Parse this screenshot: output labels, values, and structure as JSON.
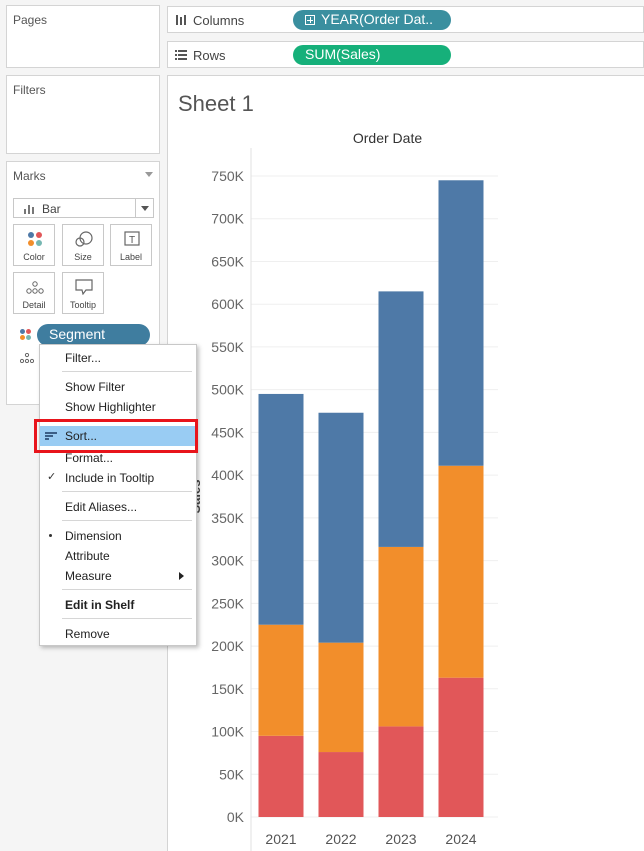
{
  "sidebar": {
    "pages_title": "Pages",
    "filters_title": "Filters",
    "marks_title": "Marks",
    "mark_type": "Bar",
    "mark_buttons": [
      "Color",
      "Size",
      "Label",
      "Detail",
      "Tooltip"
    ],
    "segment_pill": "Segment"
  },
  "shelves": {
    "columns_label": "Columns",
    "columns_pill": "YEAR(Order Dat..",
    "rows_label": "Rows",
    "rows_pill": "SUM(Sales)"
  },
  "view": {
    "sheet_title": "Sheet 1"
  },
  "context_menu": {
    "filter": "Filter...",
    "show_filter": "Show Filter",
    "show_highlighter": "Show Highlighter",
    "sort": "Sort...",
    "format": "Format...",
    "include_in_tooltip": "Include in Tooltip",
    "edit_aliases": "Edit Aliases...",
    "dimension": "Dimension",
    "attribute": "Attribute",
    "measure": "Measure",
    "edit_in_shelf": "Edit in Shelf",
    "remove": "Remove"
  },
  "colors": {
    "consumer": "#4e79a7",
    "corporate": "#f28e2b",
    "home_office": "#e15759",
    "highlight": "#99ccf3",
    "annotation_outline": "#e8141b"
  },
  "chart_data": {
    "type": "bar",
    "stacked": true,
    "title": "Order Date",
    "ylabel": "Sales",
    "categories": [
      "2021",
      "2022",
      "2023",
      "2024"
    ],
    "yticks": [
      "0K",
      "50K",
      "100K",
      "150K",
      "200K",
      "250K",
      "300K",
      "350K",
      "400K",
      "450K",
      "500K",
      "550K",
      "600K",
      "650K",
      "700K",
      "750K"
    ],
    "ylim": [
      0,
      750000
    ],
    "series": [
      {
        "color": "#e15759",
        "values": [
          95000,
          76000,
          106000,
          163000
        ]
      },
      {
        "color": "#f28e2b",
        "values": [
          130000,
          128000,
          210000,
          248000
        ]
      },
      {
        "color": "#4e79a7",
        "values": [
          270000,
          269000,
          299000,
          334000
        ]
      }
    ]
  }
}
